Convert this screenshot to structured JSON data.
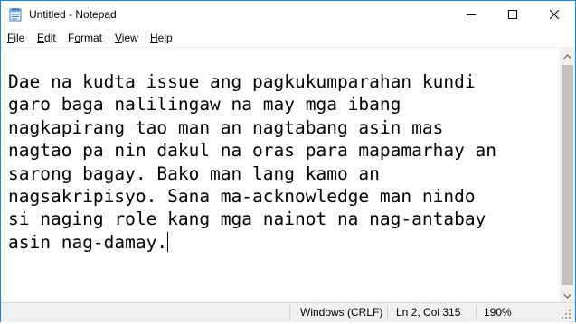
{
  "window": {
    "title": "Untitled - Notepad",
    "controls": {
      "minimize_icon": "minimize-icon",
      "maximize_icon": "maximize-icon",
      "close_icon": "close-icon"
    }
  },
  "menu": {
    "items": [
      {
        "access": "F",
        "rest": "ile"
      },
      {
        "access": "E",
        "rest": "dit"
      },
      {
        "access": "F",
        "rest": "ormat",
        "prefix": ""
      },
      {
        "access": "V",
        "rest": "iew"
      },
      {
        "access": "H",
        "rest": "elp"
      }
    ],
    "format_pre": "F",
    "format_ul": "o",
    "format_post": "rmat"
  },
  "editor": {
    "lines": [
      "Dae na kudta issue ang pagkukumparahan kundi",
      "garo baga nalilingaw na may mga ibang",
      "nagkapirang tao man an nagtabang asin mas",
      "nagtao pa nin dakul na oras para mapamarhay an",
      "sarong bagay. Bako man lang kamo an",
      "nagsakripisyo. Sana ma-acknowledge man nindo",
      "si naging role kang mga nainot na nag-antabay",
      "asin nag-damay."
    ]
  },
  "status": {
    "encoding_eol": "Windows (CRLF)",
    "position": "Ln 2, Col 315",
    "zoom": "190%"
  },
  "colors": {
    "window_border": "#1883d7",
    "statusbar_bg": "#f0f0f0",
    "scrollbar_bg": "#f0f0f0",
    "scroll_thumb": "#c0c0c0"
  }
}
